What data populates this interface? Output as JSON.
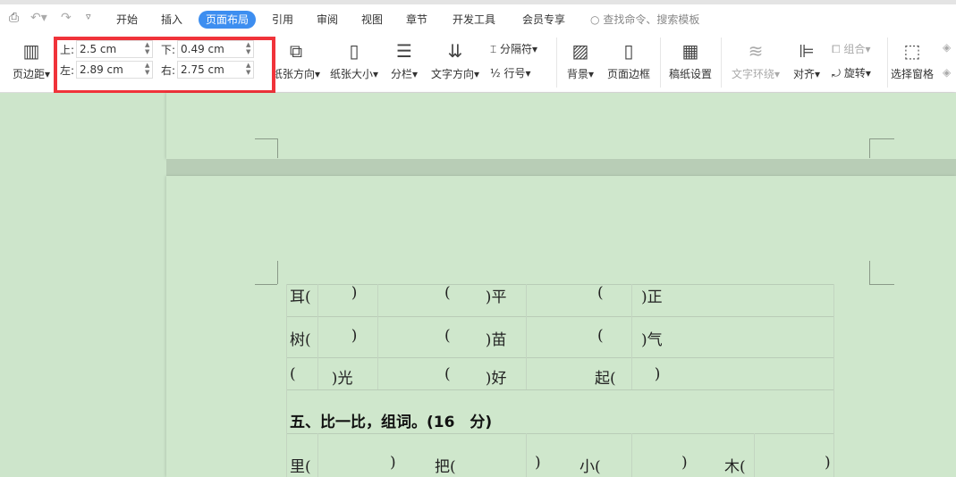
{
  "quick_access": {
    "icons": [
      "print-preview-icon",
      "undo-icon",
      "redo-icon",
      "customize-icon"
    ]
  },
  "tabs": [
    "开始",
    "插入",
    "页面布局",
    "引用",
    "审阅",
    "视图",
    "章节",
    "开发工具",
    "会员专享"
  ],
  "active_tab": "页面布局",
  "search": {
    "placeholder": "查找命令、搜索模板"
  },
  "margins": {
    "label": "页边距",
    "top_label": "上:",
    "top": "2.5 cm",
    "bottom_label": "下:",
    "bottom": "0.49 cm",
    "left_label": "左:",
    "left": "2.89 cm",
    "right_label": "右:",
    "right": "2.75 cm"
  },
  "ribbon": {
    "orientation": "纸张方向",
    "size": "纸张大小",
    "columns": "分栏",
    "text_direction": "文字方向",
    "breaks": "分隔符",
    "line_numbers": "行号",
    "background": "背景",
    "page_border": "页面边框",
    "manuscript": "稿纸设置",
    "wrap_text": "文字环绕",
    "align": "对齐",
    "group": "组合",
    "rotate": "旋转",
    "selection_pane": "选择窗格"
  },
  "highlight_color": "#f0333a",
  "accent": "#3d8ef0",
  "document": {
    "rows": [
      [
        "耳(",
        "  )",
        "(",
        "  )平",
        "(",
        ")正"
      ],
      [
        "树(",
        "  )",
        "(",
        "  )苗",
        "(",
        ")气"
      ],
      [
        "(",
        "  )光",
        "(",
        "  )好",
        "起(",
        "  )"
      ]
    ],
    "heading": "五、比一比，组词。(16　分)",
    "row5": [
      "里(",
      ")",
      "把(",
      ")",
      "小(",
      ")",
      "木(",
      ")"
    ]
  }
}
